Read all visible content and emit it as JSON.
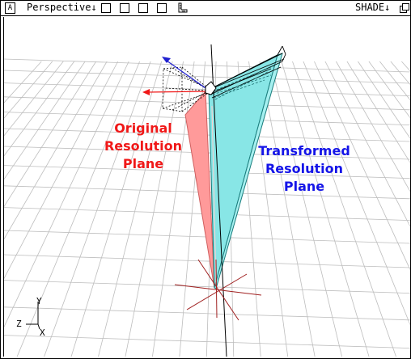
{
  "menubar": {
    "a_button": "A",
    "view_menu": "Perspective↓",
    "shade_menu": "SHADE↓"
  },
  "viewport": {
    "labels": {
      "original_line1": "Original",
      "original_line2": "Resolution",
      "original_line3": "Plane",
      "transformed_line1": "Transformed",
      "transformed_line2": "Resolution",
      "transformed_line3": "Plane"
    },
    "axes": {
      "y": "Y",
      "z": "Z",
      "x": "X"
    }
  },
  "colors": {
    "original_plane": "#ff9a9a",
    "transformed_plane": "#88e6e6",
    "original_arrow": "#f01818",
    "transformed_arrow": "#2020d0",
    "grid": "#bdbdbd"
  }
}
